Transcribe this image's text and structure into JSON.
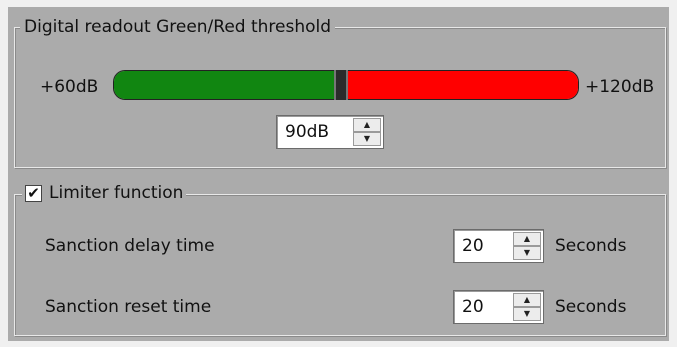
{
  "threshold": {
    "title": "Digital readout Green/Red threshold",
    "min_label": "+60dB",
    "max_label": "+120dB",
    "min_db": 60,
    "max_db": 120,
    "value_db": 90,
    "value_text": "90dB",
    "green_color": "#118611",
    "red_color": "#ff0000"
  },
  "limiter": {
    "title": "Limiter function",
    "enabled": true,
    "check_glyph": "✔",
    "rows": [
      {
        "label": "Sanction delay time",
        "value": "20",
        "unit": "Seconds"
      },
      {
        "label": "Sanction reset time",
        "value": "20",
        "unit": "Seconds"
      }
    ]
  },
  "icons": {
    "spin_up": "▲",
    "spin_down": "▼"
  }
}
